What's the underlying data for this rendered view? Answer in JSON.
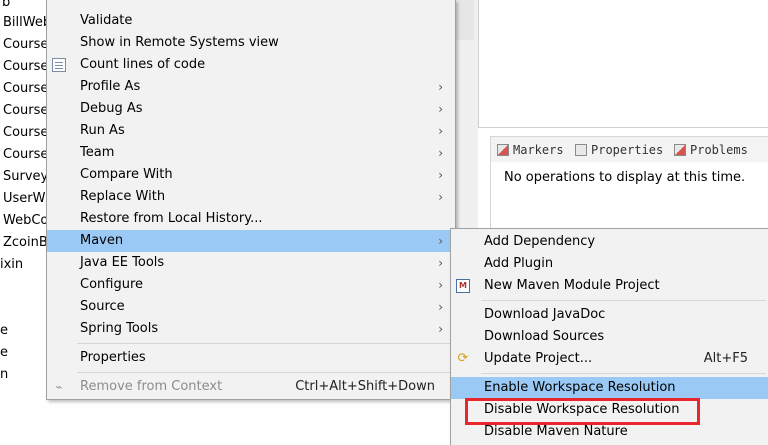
{
  "tree": {
    "items": [
      "b",
      "BillWeb",
      "Course",
      "Course",
      "Course",
      "Course",
      "Course",
      "Course",
      "Survey",
      "UserW",
      "WebCo",
      "ZcoinB",
      "ixin",
      "",
      "",
      "e",
      "e",
      "n"
    ]
  },
  "views": {
    "tabs": [
      {
        "label": "Markers",
        "icon": "markers-icon"
      },
      {
        "label": "Properties",
        "icon": "properties-icon"
      },
      {
        "label": "Problems",
        "icon": "problems-icon"
      }
    ],
    "message": "No operations to display at this time."
  },
  "context_menu": {
    "items": [
      {
        "label": "Validate"
      },
      {
        "label": "Show in Remote Systems view"
      },
      {
        "label": "Count lines of code",
        "icon": "document-icon"
      },
      {
        "label": "Profile As",
        "submenu": true
      },
      {
        "label": "Debug As",
        "submenu": true
      },
      {
        "label": "Run As",
        "submenu": true
      },
      {
        "label": "Team",
        "submenu": true
      },
      {
        "label": "Compare With",
        "submenu": true
      },
      {
        "label": "Replace With",
        "submenu": true
      },
      {
        "label": "Restore from Local History..."
      },
      {
        "label": "Maven",
        "submenu": true,
        "highlighted": true
      },
      {
        "label": "Java EE Tools",
        "submenu": true
      },
      {
        "label": "Configure",
        "submenu": true
      },
      {
        "label": "Source",
        "submenu": true
      },
      {
        "label": "Spring Tools",
        "submenu": true
      },
      {
        "label": "Properties"
      },
      {
        "label": "Remove from Context",
        "shortcut": "Ctrl+Alt+Shift+Down",
        "disabled": true
      }
    ],
    "arrow_glyph": "›"
  },
  "maven_submenu": {
    "items": [
      {
        "label": "Add Dependency"
      },
      {
        "label": "Add Plugin"
      },
      {
        "label": "New Maven Module Project",
        "icon": "maven-module-icon"
      },
      {
        "label": "Download JavaDoc"
      },
      {
        "label": "Download Sources"
      },
      {
        "label": "Update Project...",
        "shortcut": "Alt+F5",
        "icon": "update-project-icon"
      },
      {
        "label": "Enable Workspace Resolution",
        "highlighted": true
      },
      {
        "label": "Disable Workspace Resolution",
        "annotated": true
      },
      {
        "label": "Disable Maven Nature"
      }
    ]
  },
  "colors": {
    "highlight": "#99c9f4",
    "annotation_box": "#e8262b",
    "menu_background": "#f2f2f2"
  }
}
